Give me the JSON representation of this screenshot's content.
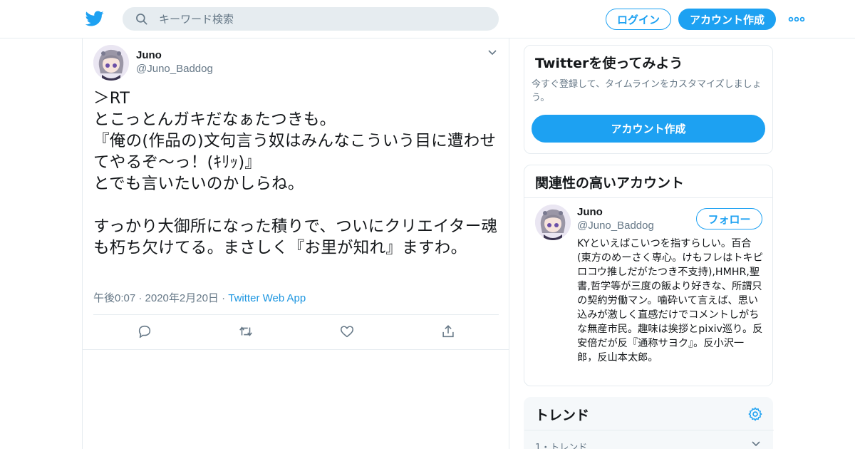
{
  "header": {
    "search_placeholder": "キーワード検索",
    "login_label": "ログイン",
    "signup_label": "アカウント作成"
  },
  "tweet": {
    "author_name": "Juno",
    "author_handle": "@Juno_Baddog",
    "text": "＞RT\nとこっとんガキだなぁたつきも。\n『俺の(作品の)文句言う奴はみんなこういう目に遭わせてやるぞ～っ！(ｷﾘｯ)』\nとでも言いたいのかしらね。\n\nすっかり大御所になった積りで、ついにクリエイター魂も朽ち欠けてる。まさしく『お里が知れ』ますわ。",
    "time": "午後0:07 · 2020年2月20日 · ",
    "source": "Twitter Web App"
  },
  "signup_card": {
    "title": "Twitterを使ってみよう",
    "subtitle": "今すぐ登録して、タイムラインをカスタマイズしましょう。",
    "button_label": "アカウント作成"
  },
  "related_card": {
    "title": "関連性の高いアカウント",
    "account": {
      "name": "Juno",
      "handle": "@Juno_Baddog",
      "follow_label": "フォロー",
      "bio": "KYといえばこいつを指すらしい。百合(東方のめーさく専心。けもフレはトキピロコウ推しだがたつき不支持),HMHR,聖書,哲学等が三度の飯より好きな、所謂只の契約労働マン。噛砕いて言えば、思い込みが激しく直感だけでコメントしがちな無産市民。趣味は挨拶とpixiv巡り。反安倍だが反『通称サヨク』。反小沢一郎，反山本太郎。"
    }
  },
  "trends_card": {
    "title": "トレンド",
    "first_item_label": "1・トレンド"
  },
  "colors": {
    "brand_blue": "#1da1f2",
    "secondary_text": "#657786",
    "border": "#e6ecf0"
  },
  "icons": [
    "twitter-bird-icon",
    "search-icon",
    "more-dots-icon",
    "chevron-down-icon",
    "reply-icon",
    "retweet-icon",
    "like-icon",
    "share-icon",
    "gear-icon"
  ]
}
